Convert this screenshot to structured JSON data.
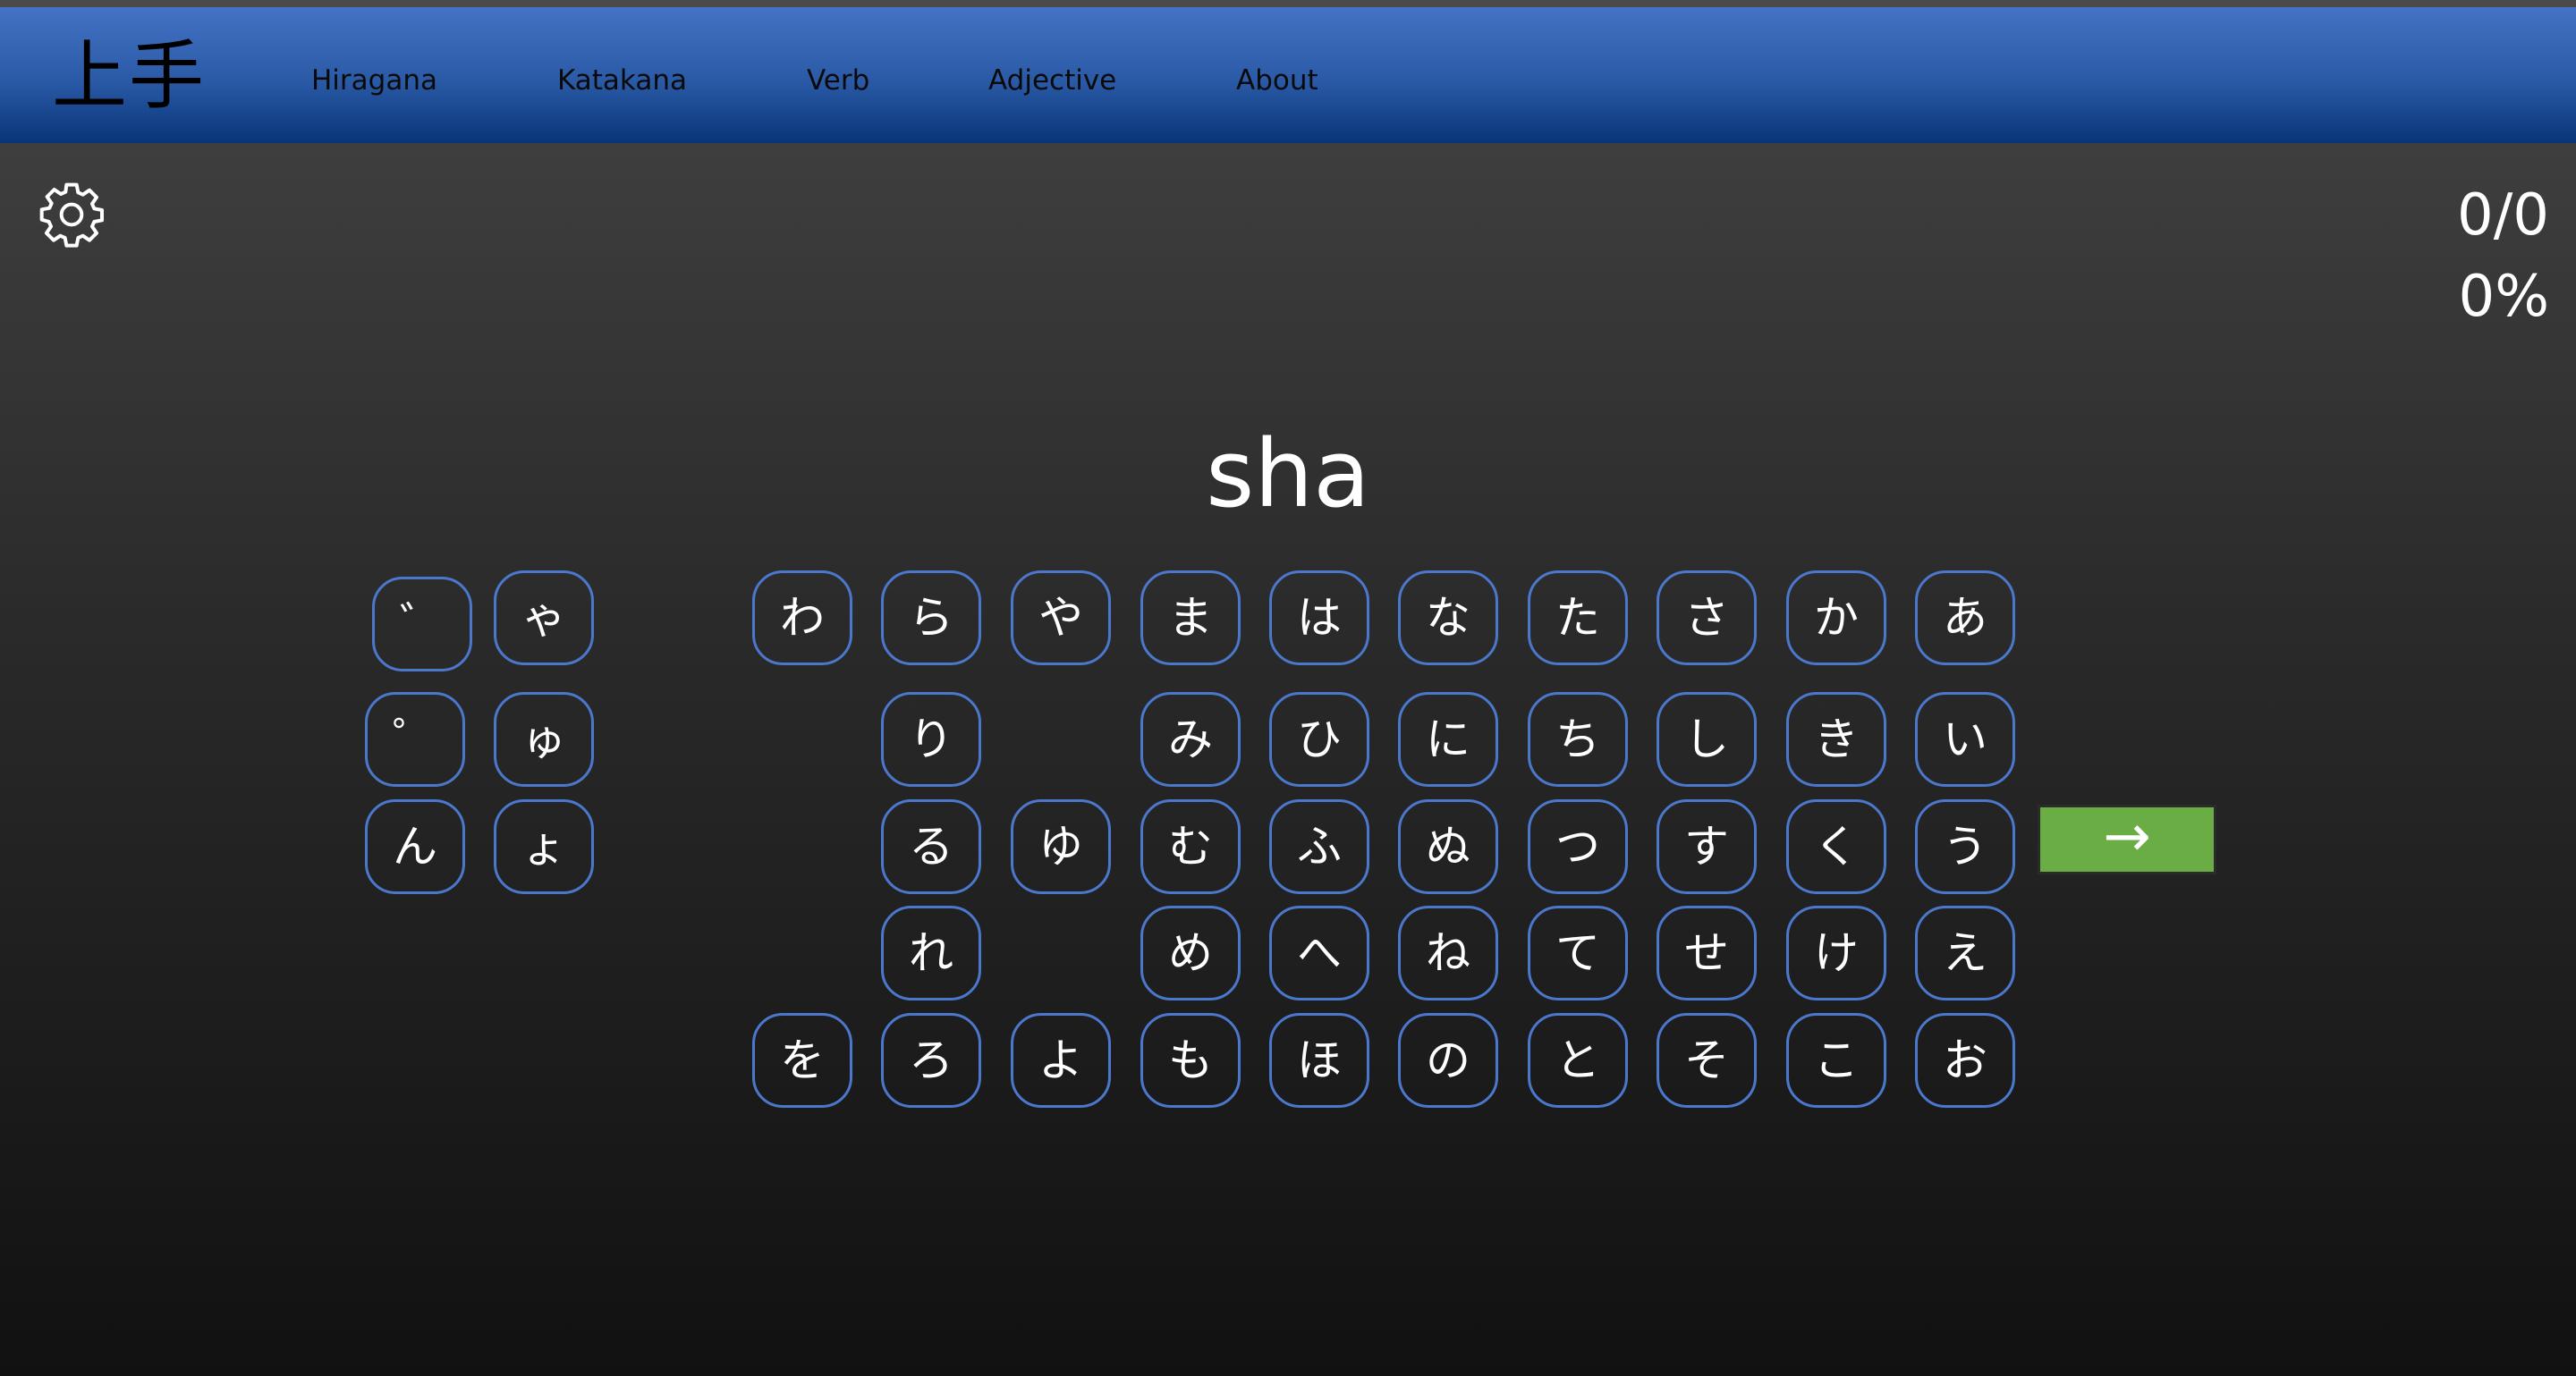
{
  "app": {
    "logo": "上手"
  },
  "nav": {
    "items": [
      "Hiragana",
      "Katakana",
      "Verb",
      "Adjective",
      "About"
    ]
  },
  "settings": {
    "icon": "gear-icon"
  },
  "score": {
    "count": "0/0",
    "percent": "0%"
  },
  "quiz": {
    "prompt": "sha"
  },
  "modifiers": [
    "゛",
    "ゃ",
    "゜",
    "ゅ",
    "ん",
    "ょ"
  ],
  "kana_rows": [
    [
      "わ",
      "ら",
      "や",
      "ま",
      "は",
      "な",
      "た",
      "さ",
      "か",
      "あ"
    ],
    [
      "り",
      "み",
      "ひ",
      "に",
      "ち",
      "し",
      "き",
      "い"
    ],
    [
      "る",
      "ゆ",
      "む",
      "ふ",
      "ぬ",
      "つ",
      "す",
      "く",
      "う"
    ],
    [
      "れ",
      "め",
      "へ",
      "ね",
      "て",
      "せ",
      "け",
      "え"
    ],
    [
      "を",
      "ろ",
      "よ",
      "も",
      "ほ",
      "の",
      "と",
      "そ",
      "こ",
      "お"
    ]
  ],
  "next_button": {
    "label": "→"
  },
  "colors": {
    "nav_top": "#4472c4",
    "nav_bottom": "#083478",
    "key_border": "#4b78cc",
    "next_bg": "#6aad45"
  }
}
